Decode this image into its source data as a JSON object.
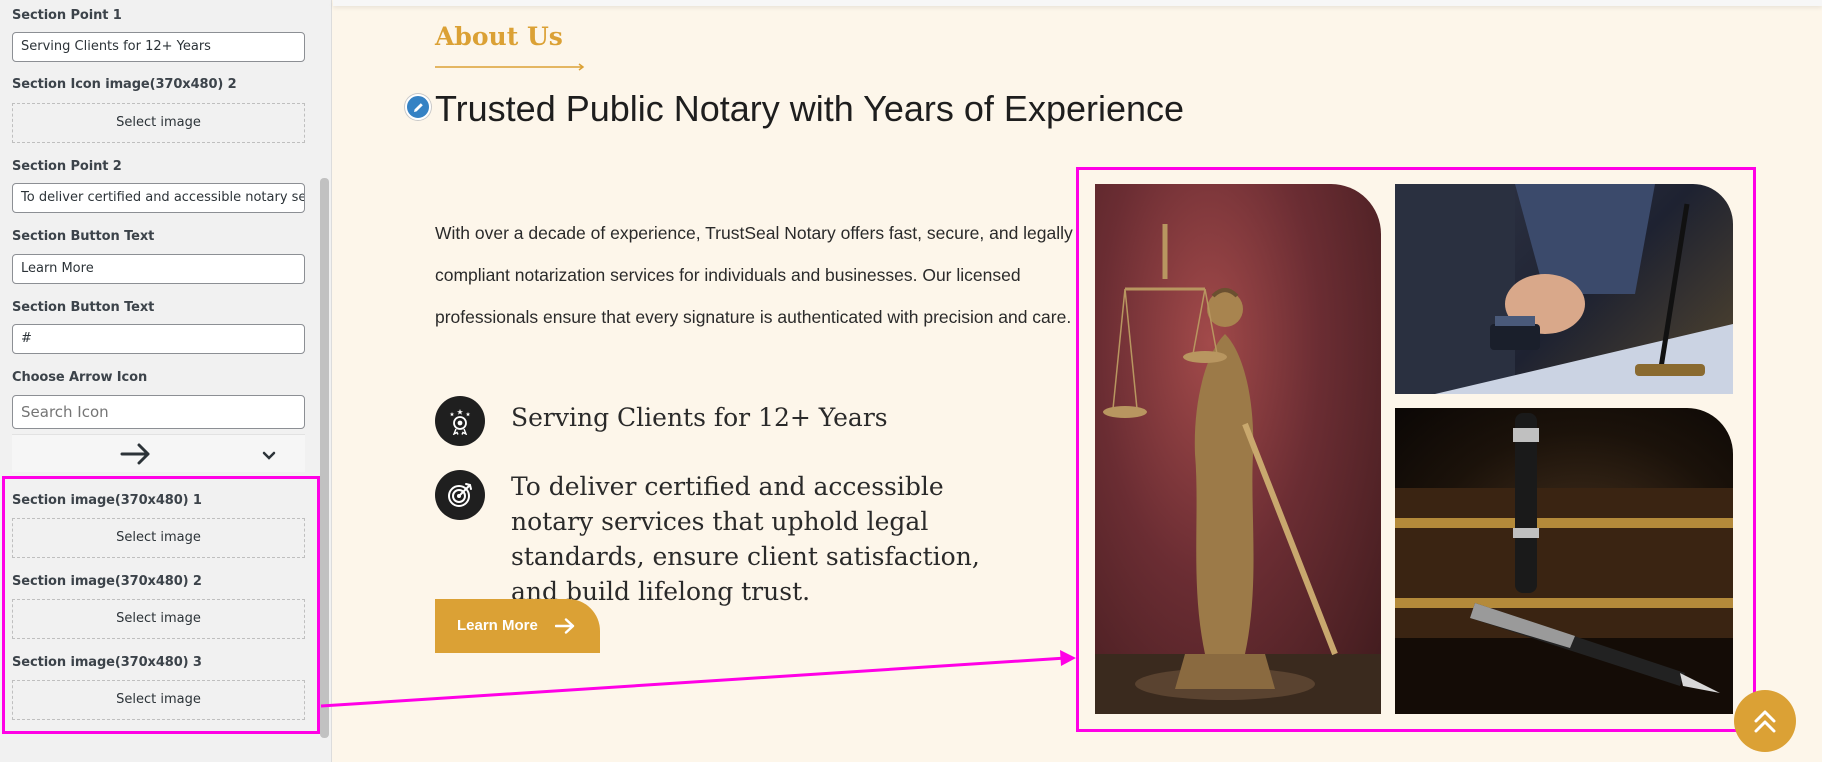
{
  "panel": {
    "fields": [
      {
        "label": "Section Point 1",
        "value": "Serving Clients for 12+ Years"
      },
      {
        "label": "Section Icon image(370x480) 2",
        "button": "Select image"
      },
      {
        "label": "Section Point 2",
        "value": "To deliver certified and accessible notary se"
      },
      {
        "label": "Section Button Text",
        "value": "Learn More"
      },
      {
        "label": "Section Button Text",
        "value": "#"
      },
      {
        "label": "Choose Arrow Icon",
        "placeholder": "Search Icon"
      },
      {
        "label": "Section image(370x480) 1",
        "button": "Select image"
      },
      {
        "label": "Section image(370x480) 2",
        "button": "Select image"
      },
      {
        "label": "Section image(370x480) 3",
        "button": "Select image"
      }
    ]
  },
  "preview": {
    "eyebrow": "About Us",
    "headline": "Trusted Public Notary with Years of Experience",
    "description": "With over a decade of experience, TrustSeal Notary offers fast, secure, and legally compliant notarization services for individuals and businesses. Our licensed professionals ensure that every signature is authenticated with precision and care.",
    "points": [
      {
        "icon": "award-icon",
        "text": "Serving Clients for 12+ Years"
      },
      {
        "icon": "target-icon",
        "text": "To deliver certified and accessible notary services that uphold legal standards, ensure client satisfaction, and build lifelong trust."
      }
    ],
    "button": {
      "label": "Learn More",
      "icon": "arrow-right-icon"
    },
    "images": [
      "justice-statue-image",
      "notary-stamp-image",
      "fountain-pen-image"
    ]
  },
  "colors": {
    "accent": "#dba135",
    "highlight": "#ff00e6",
    "dark": "#1f1f1f",
    "page_background": "#fdf6ea"
  }
}
